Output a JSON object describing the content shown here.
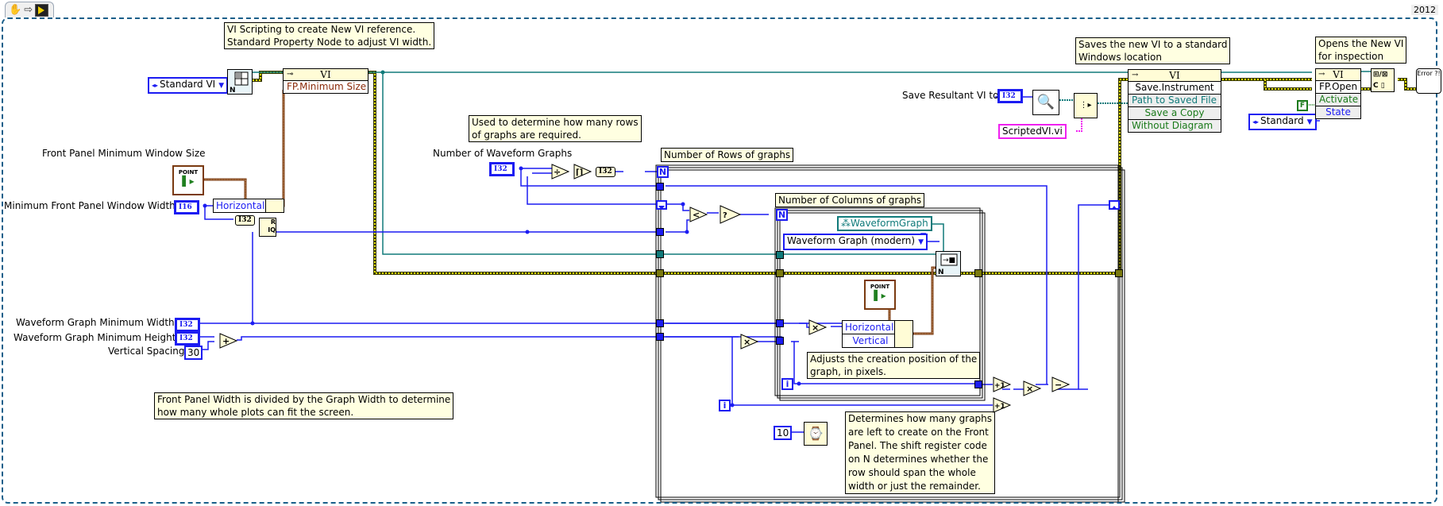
{
  "toolbar": {
    "icons": [
      "hand-grab-icon",
      "arrow-right-icon",
      "run-vi-icon"
    ],
    "version": "2012"
  },
  "comments": {
    "vi_scripting": [
      "VI Scripting to create  New VI reference.",
      "Standard Property Node to adjust VI width."
    ],
    "rows_required": [
      "Used to determine how many rows",
      "of graphs are required."
    ],
    "rows_label": "Number of Rows of graphs",
    "cols_label": "Number of Columns of graphs",
    "adjusts_position": [
      "Adjusts the creation position of the",
      "graph, in pixels."
    ],
    "fp_width_divided": [
      "Front Panel Width is divided by the Graph Width to determine",
      "how many whole plots can fit the screen."
    ],
    "graphs_left": [
      "Determines how many graphs",
      "are left to create on the Front",
      "Panel.  The shift register code",
      "on N determines whether the",
      "row should span the whole",
      "width or just the remainder."
    ],
    "saves_new_vi": [
      "Saves the new VI to a standard",
      "Windows location"
    ],
    "opens_new_vi": [
      "Opens the New VI",
      "for inspection"
    ]
  },
  "controls": {
    "standard_vi_enum": "Standard VI",
    "fp_min_window_size_label": "Front Panel Minimum Window Size",
    "fp_min_window_size_type": "POINT",
    "min_fp_window_width_label": "Minimum Front Panel Window Width",
    "min_fp_window_width_type": "I16",
    "num_waveform_graphs_label": "Number of Waveform Graphs",
    "num_waveform_graphs_type": "I32",
    "wg_min_width_label": "Waveform Graph Minimum Width",
    "wg_min_width_type": "I32",
    "wg_min_height_label": "Waveform Graph Minimum Height",
    "wg_min_height_type": "I32",
    "vertical_spacing_label": "Vertical Spacing",
    "vertical_spacing_value": "30",
    "save_resultant_label": "Save Resultant VI to:",
    "save_resultant_type": "I32",
    "scripted_vi_path": "ScriptedVI.vi",
    "waveform_graph_style": "Waveform Graph (modern)",
    "waveform_graph_ref": "WaveformGraph",
    "wait_ms_value": "10",
    "fp_open_state": "Standard",
    "activate_value": "F",
    "inner_point_type": "POINT"
  },
  "nodes": {
    "prop_min_size": {
      "class": "VI",
      "properties": [
        "FP.Minimum Size"
      ]
    },
    "invoke_save": {
      "class": "VI",
      "method": "Save.Instrument",
      "params": [
        "Path to Saved File",
        "Save a Copy",
        "Without Diagram"
      ]
    },
    "invoke_open": {
      "class": "VI",
      "method": "FP.Open",
      "params": [
        "Activate",
        "State"
      ]
    },
    "unbundle_horizontal": "Horizontal",
    "bundle_fields": [
      "Horizontal",
      "Vertical"
    ],
    "to_i32_1": "I32",
    "to_i32_2": "I32",
    "quotient_remainder": [
      "R",
      "IQ"
    ],
    "primitives": {
      "divide": "÷",
      "ceiling": "⌈⌉",
      "less_than": "<",
      "select": "?",
      "multiply": "×",
      "add": "+",
      "subtract": "−",
      "increment": "+1"
    },
    "loop_count": "N",
    "loop_index": "i",
    "error_handler": "Error ?!"
  }
}
